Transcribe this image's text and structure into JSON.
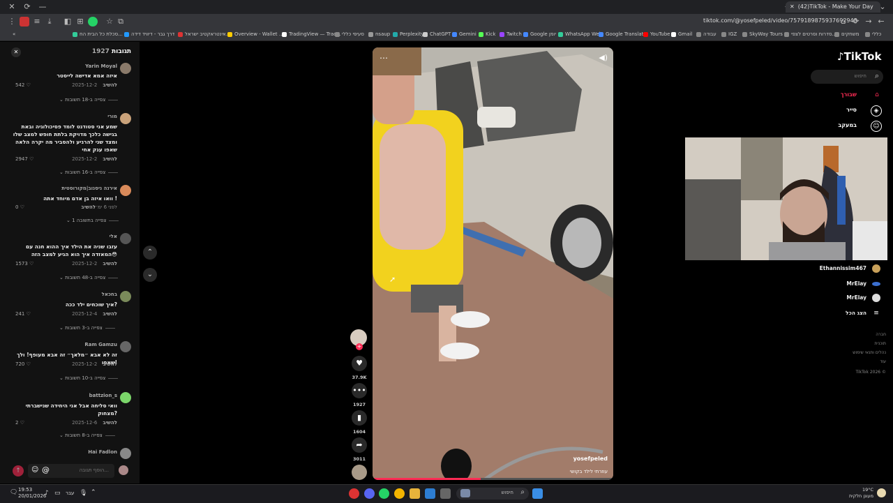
{
  "browser": {
    "tab_title": "(42)TikTok - Make Your Day",
    "url": "tiktok.com/@yosefpeled/video/7579189875937692948",
    "bookmarks": [
      "סכלת כל הבית הח...",
      "דרך גבר - דיוויד דידה",
      "אינטראקטיב ישראל...",
      "Overview - Wallet ...",
      "TradingView — Trac...",
      "סעיפי כללי",
      "nsaup",
      "Perplexity",
      "ChatGPT",
      "Gemini",
      "Kick",
      "Twitch",
      "Google יומן",
      "WhatsApp Web",
      "Google Translate",
      "YouTube",
      "Gmail",
      "עבודה",
      "IGZ",
      "SkyWay Tours",
      "סדרות וסרטים לצפי...",
      "משחקים",
      "כללי"
    ]
  },
  "comments_panel": {
    "header": "תגובות",
    "count": "1927",
    "reply_label": "להשיב",
    "comments": [
      {
        "user": "Yarin Moyal",
        "text": "איזה אמא אדישה לייסטר",
        "date": "2025-12-2",
        "likes": "542",
        "more": "צפייה ב-18 תשובות"
      },
      {
        "user": "מורי",
        "text": "שמע אני סטודנט לומד פסיכולוגיה ובאת בגישה כלכך מדויקת בלתת חופש למצב שלו ומצד שני להרגיע ולהסביר מה יקרה הלאה שאפו ענק אחי",
        "date": "2025-12-2",
        "likes": "2947",
        "more": "צפייה ב-16 תשובות"
      },
      {
        "user": "אירנה ניסנוב|מקורוסטית",
        "text": "וואו איזה בן אדם מיוחד אתה !",
        "date": "לפני 6 ימ׳",
        "likes": "0",
        "more": "צפייה בתשובה 1"
      },
      {
        "user": "אלי",
        "text": "עזבו שניה את הילד איך ההוא חנה עם המאזדה איך הוא הגיע למצב הזה😳",
        "date": "2025-12-2",
        "likes": "1573",
        "more": "צפייה ב-48 תשובות"
      },
      {
        "user": "בחכאל",
        "text": "איך שוכחים ילד ככה?",
        "date": "2025-12-4",
        "likes": "241",
        "more": "צפייה ב-3 תשובות"
      },
      {
        "user": "Ram Gamzu",
        "text": "זה לא אבא ״מלאך״ זה אבא מעופף! ולך שאפו!",
        "date": "2025-12-2",
        "likes": "720",
        "more": "צפייה ב-10 תשובות"
      },
      {
        "user": "battzion_s",
        "text": "וואי סליחה אבל אני היחידה שנישברתי מצחוק?",
        "date": "2025-12-6",
        "likes": "2",
        "more": "צפייה ב-8 תשובות"
      },
      {
        "user": "Hai Fadlon",
        "text": "",
        "date": "",
        "likes": "",
        "more": ""
      }
    ],
    "input_placeholder": "הוסף תגובה...",
    "at_symbol": "@"
  },
  "video": {
    "author_watermark": "yosefpeled",
    "caption": "עוזרתי לילד בקושי",
    "progress": 0.45
  },
  "actions": {
    "likes": "37.9K",
    "comments": "1927",
    "saves": "1604",
    "shares": "3011"
  },
  "sidebar": {
    "logo": "TikTok",
    "search_placeholder": "חיפוש",
    "nav": [
      "שבורך",
      "סייר",
      "במעקב"
    ],
    "following": [
      "Ethannissim467",
      "MrElay",
      "MrElay"
    ],
    "show_more": "הצג הכל",
    "footer": [
      "חברה",
      "תוכנית",
      "נהלים ותנאי שימוש",
      "עוד",
      "TikTok 2026 ©"
    ]
  },
  "taskbar": {
    "time": "19:53",
    "date": "20/01/2026",
    "lang": "עבר",
    "search": "חיפוש",
    "weather": "19°C",
    "weather_desc": "מעונן חלקית"
  },
  "colors": {
    "accent": "#fe2c55",
    "bg": "#000000",
    "panel": "#121212"
  }
}
